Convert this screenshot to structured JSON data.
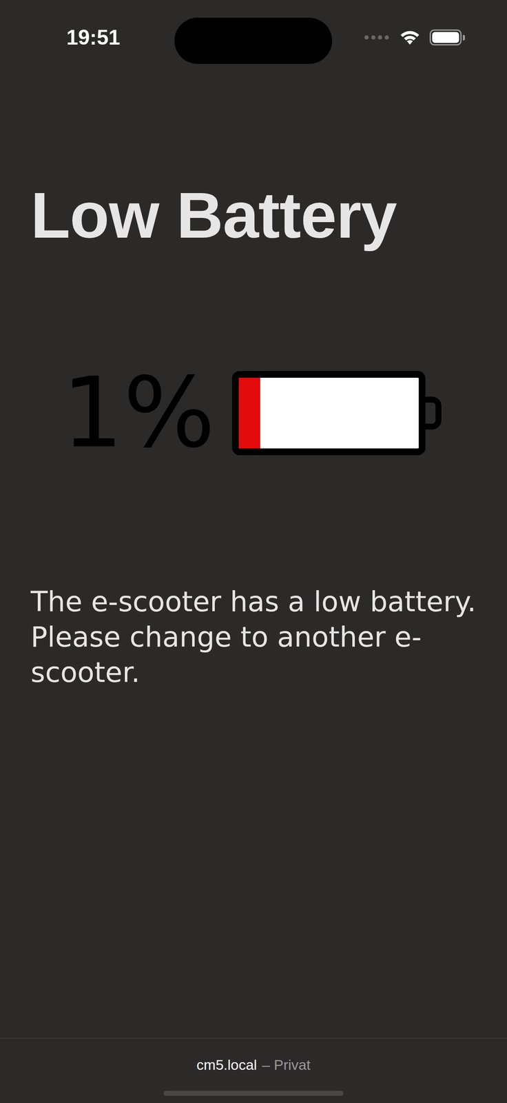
{
  "status_bar": {
    "time": "19:51",
    "battery_level": 1
  },
  "title": "Low Battery",
  "illustration": {
    "label": "1%",
    "level": 0.12
  },
  "message": "The e-scooter has a low battery. Please change to another e-scooter.",
  "footer": {
    "host": "cm5.local",
    "suffix": "– Privat"
  }
}
